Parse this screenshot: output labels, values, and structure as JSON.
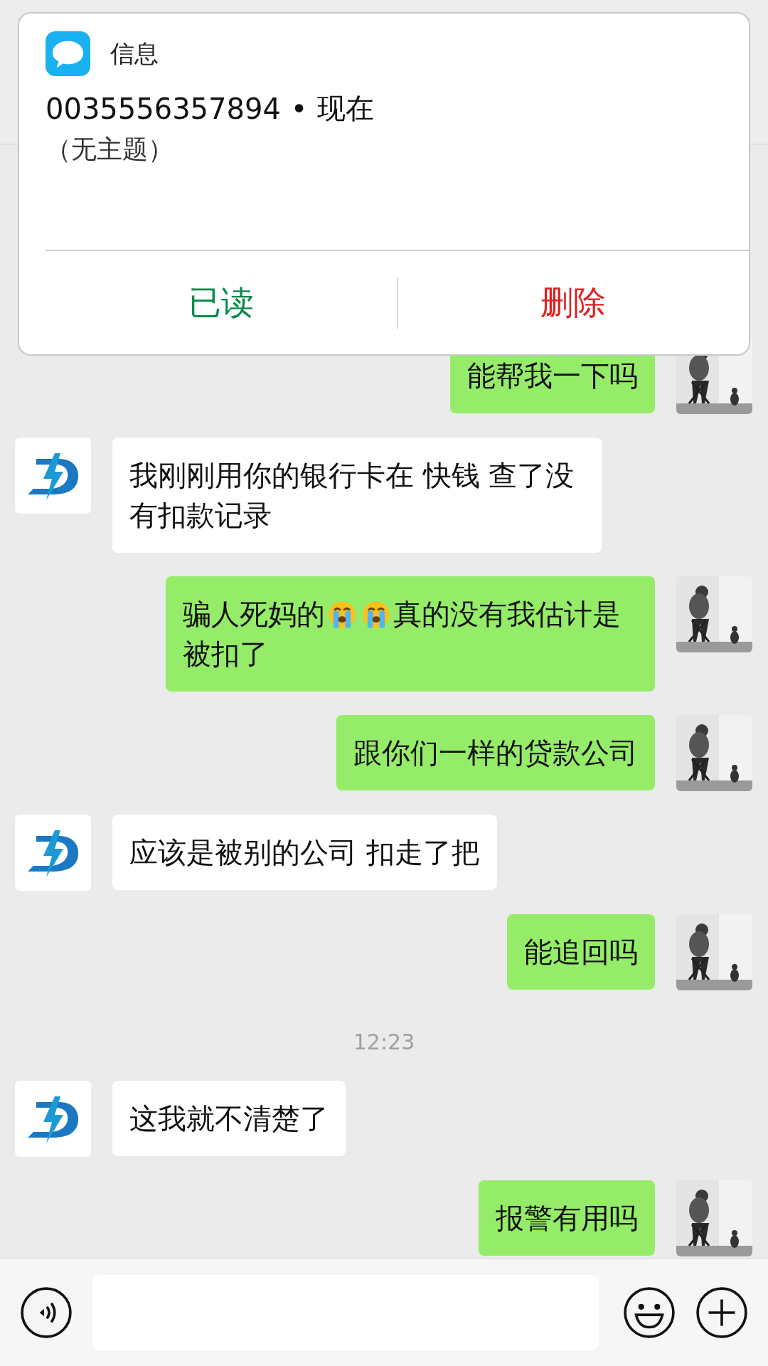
{
  "notification": {
    "app": "信息",
    "sender": "0035556357894",
    "separator": "•",
    "time": "现在",
    "subject": "（无主题）",
    "actions": [
      {
        "label": "已读",
        "kind": "confirm"
      },
      {
        "label": "删除",
        "kind": "danger"
      }
    ]
  },
  "messages": [
    {
      "kind": "outgoing",
      "parts": [
        {
          "kind": "text",
          "text": "能帮我一下吗"
        }
      ]
    },
    {
      "kind": "incoming",
      "parts": [
        {
          "kind": "text",
          "text": "我刚刚用你的银行卡在 快钱 查了没有扣款记录"
        }
      ]
    },
    {
      "kind": "outgoing",
      "parts": [
        {
          "kind": "text",
          "text": "骗人死妈的"
        },
        {
          "kind": "emoji"
        },
        {
          "kind": "emoji"
        },
        {
          "kind": "text",
          "text": "真的没有我估计是"
        },
        {
          "kind": "text",
          "text": "被扣了"
        }
      ]
    },
    {
      "kind": "outgoing",
      "parts": [
        {
          "kind": "text",
          "text": "跟你们一样的贷款公司"
        }
      ]
    },
    {
      "kind": "incoming",
      "parts": [
        {
          "kind": "text",
          "text": "应该是被别的公司 扣走了把"
        }
      ]
    },
    {
      "kind": "outgoing",
      "parts": [
        {
          "kind": "text",
          "text": "能追回吗"
        }
      ]
    },
    {
      "kind": "time",
      "text": "12:23"
    },
    {
      "kind": "incoming",
      "parts": [
        {
          "kind": "text",
          "text": "这我就不清楚了"
        }
      ]
    },
    {
      "kind": "outgoing",
      "parts": [
        {
          "kind": "text",
          "text": "报警有用吗"
        }
      ]
    }
  ]
}
